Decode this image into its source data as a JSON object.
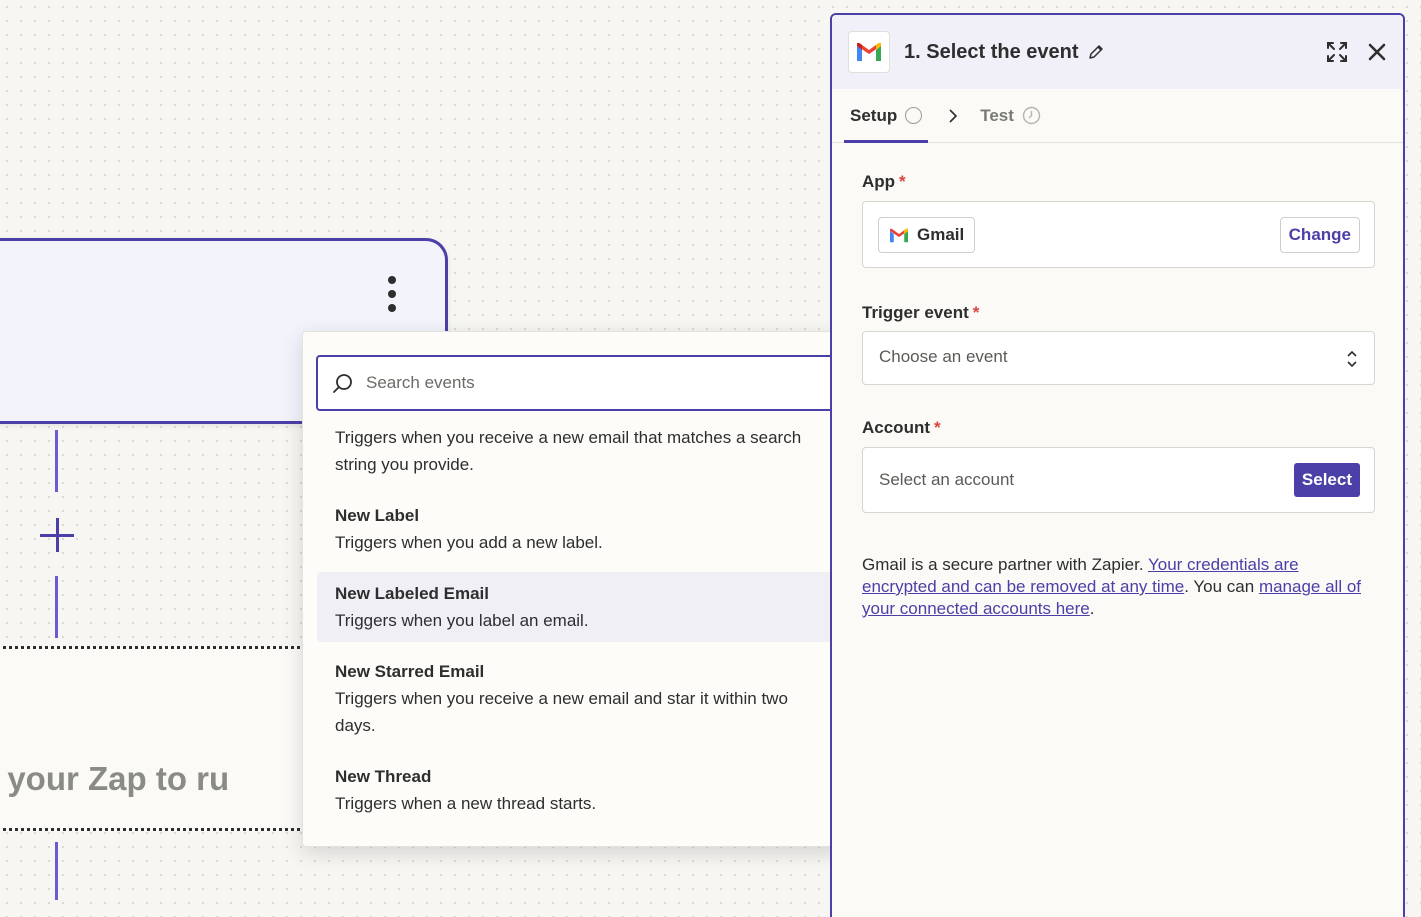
{
  "canvas": {
    "action_placeholder_text": "t for your Zap to ru"
  },
  "dropdown": {
    "search_placeholder": "Search events",
    "events": [
      {
        "title": "",
        "description": "Triggers when you receive a new email that matches a search string you provide."
      },
      {
        "title": "New Label",
        "description": "Triggers when you add a new label."
      },
      {
        "title": "New Labeled Email",
        "description": "Triggers when you label an email."
      },
      {
        "title": "New Starred Email",
        "description": "Triggers when you receive a new email and star it within two days."
      },
      {
        "title": "New Thread",
        "description": "Triggers when a new thread starts."
      }
    ]
  },
  "panel": {
    "title": "1. Select the event",
    "tabs": [
      {
        "label": "Setup",
        "status_icon": "empty-circle-icon"
      },
      {
        "label": "Test",
        "status_icon": "clock-circle-icon"
      }
    ],
    "app": {
      "label": "App",
      "required": "*",
      "value": "Gmail",
      "change_label": "Change"
    },
    "trigger_event": {
      "label": "Trigger event",
      "required": "*",
      "placeholder": "Choose an event"
    },
    "account": {
      "label": "Account",
      "required": "*",
      "placeholder": "Select an account",
      "select_label": "Select"
    },
    "partner_note": {
      "prefix": "Gmail is a secure partner with Zapier. ",
      "link1": "Your credentials are encrypted and can be removed at any time",
      "middle": ". You can ",
      "link2": "manage all of your connected accounts here",
      "suffix": "."
    }
  },
  "colors": {
    "accent": "#4b3fa8",
    "required": "#d9453a",
    "canvas_bg": "#f7f6f2"
  }
}
